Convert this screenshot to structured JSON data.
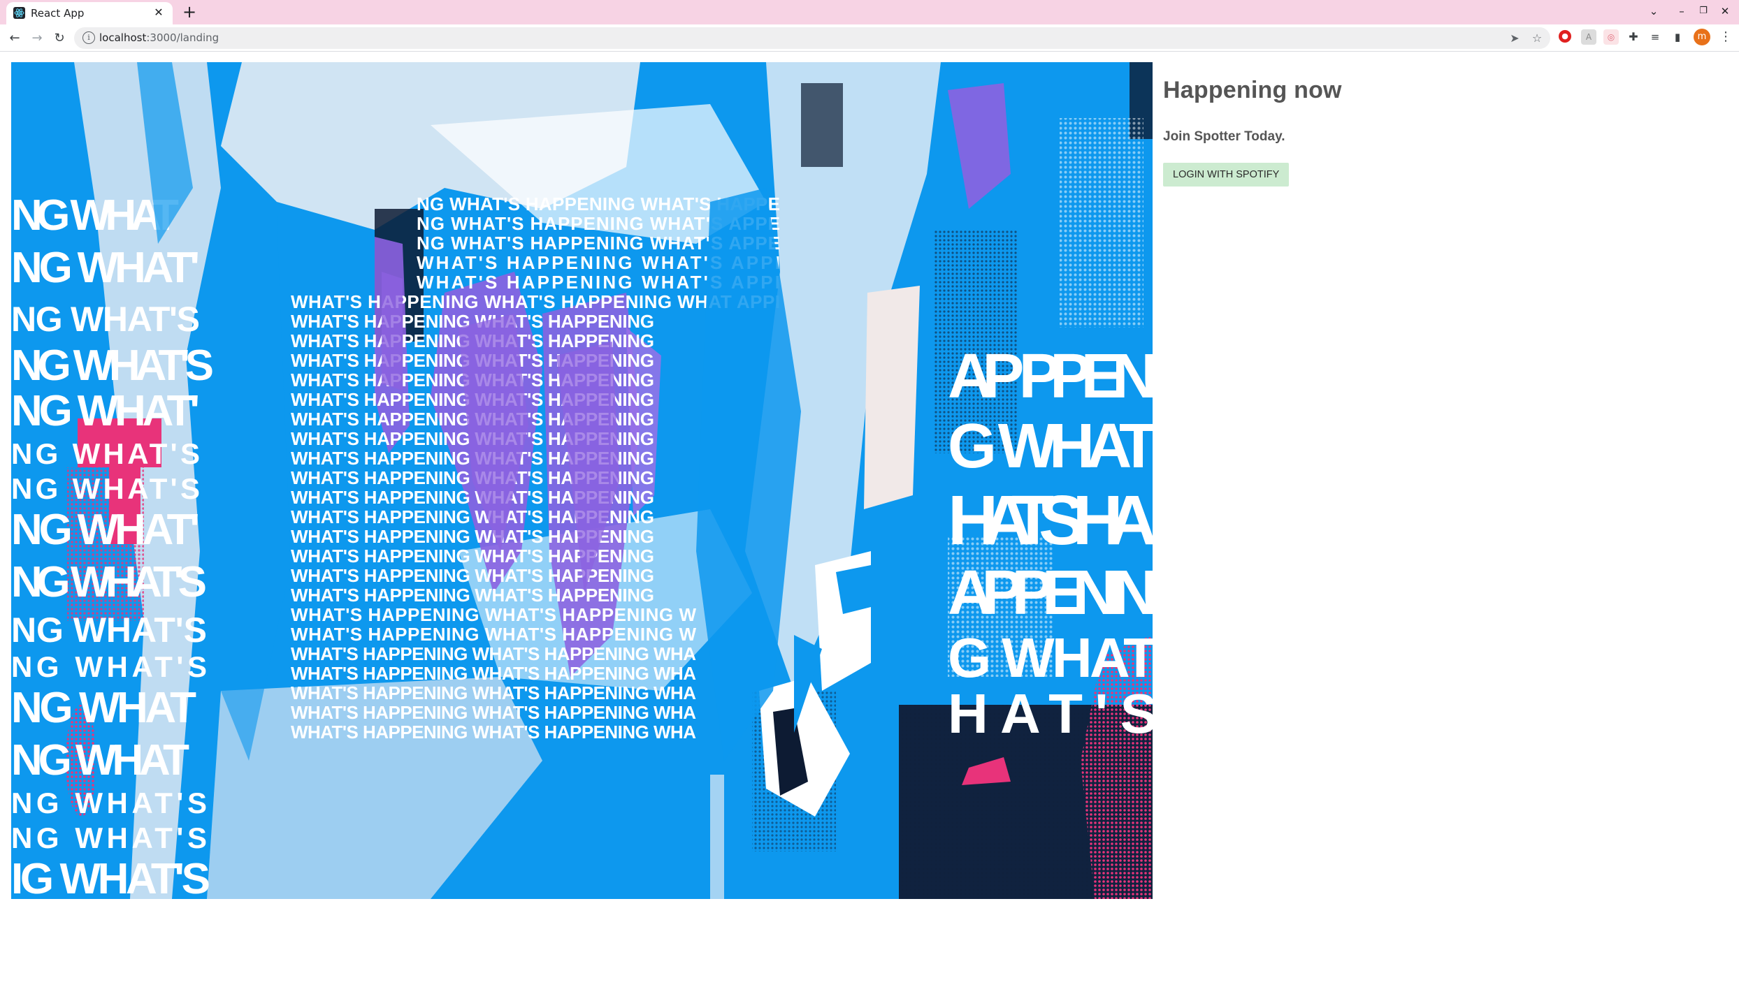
{
  "browser": {
    "tab_title": "React App",
    "url_host": "localhost",
    "url_path": ":3000/landing"
  },
  "landing": {
    "hero_text": [
      "WHAT'S HAPPENING",
      "NG WHAT'S",
      "HAT'S HA",
      "APPENI"
    ],
    "headline": "Happening now",
    "subheadline": "Join Spotter Today.",
    "login_button": "LOGIN WITH SPOTIFY"
  },
  "colors": {
    "tab_strip": "#f7d3e4",
    "hero_blue": "#0d98ee",
    "button_green": "#ccebd0",
    "text_gray": "#555555",
    "profile_orange": "#e8711a"
  }
}
